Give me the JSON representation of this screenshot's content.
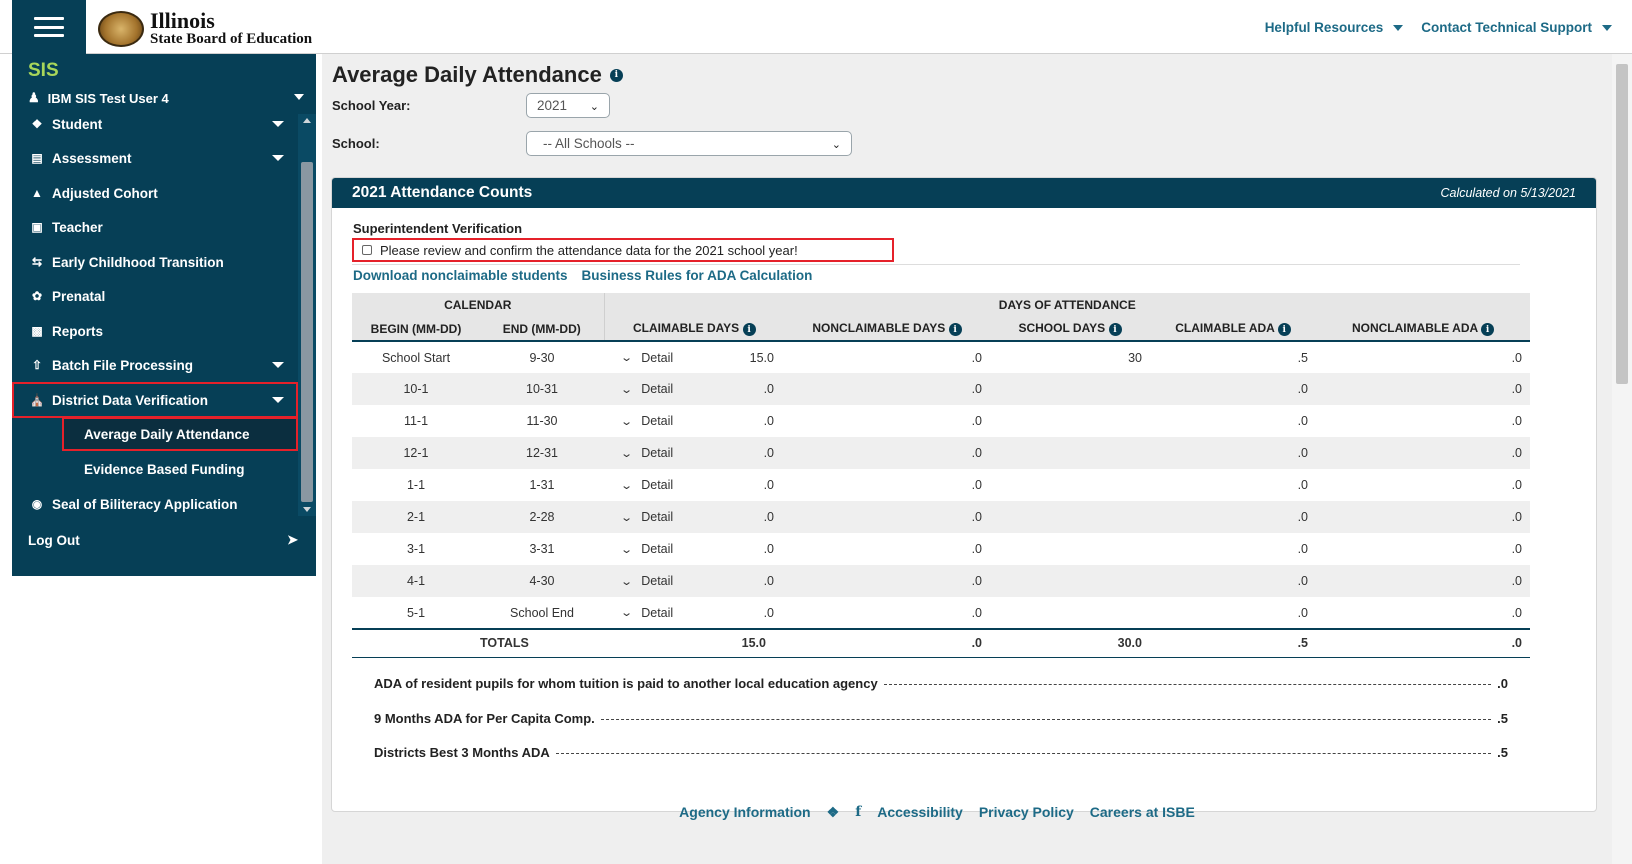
{
  "header": {
    "logo_line1": "Illinois",
    "logo_line2": "State Board of Education",
    "links": [
      "Helpful Resources",
      "Contact Technical Support"
    ]
  },
  "sidebar": {
    "app": "SIS",
    "user": "IBM SIS Test User 4",
    "items": [
      {
        "label": "Student",
        "icon": "student-icon"
      },
      {
        "label": "Assessment",
        "icon": "assessment-icon"
      },
      {
        "label": "Adjusted Cohort",
        "icon": "cohort-icon"
      },
      {
        "label": "Teacher",
        "icon": "teacher-icon"
      },
      {
        "label": "Early Childhood Transition",
        "icon": "transition-icon"
      },
      {
        "label": "Prenatal",
        "icon": "prenatal-icon"
      },
      {
        "label": "Reports",
        "icon": "reports-icon"
      },
      {
        "label": "Batch File Processing",
        "icon": "upload-icon"
      },
      {
        "label": "District Data Verification",
        "icon": "district-icon"
      }
    ],
    "subitems": [
      "Average Daily Attendance",
      "Evidence Based Funding"
    ],
    "seal": "Seal of Biliteracy Application",
    "logout": "Log Out"
  },
  "main": {
    "title": "Average Daily Attendance",
    "school_year_label": "School Year:",
    "school_year_value": "2021",
    "school_label": "School:",
    "school_value": "-- All Schools --",
    "card_title": "2021 Attendance Counts",
    "calculated": "Calculated on 5/13/2021",
    "sv_label": "Superintendent Verification",
    "confirm_text": "Please review and confirm the attendance data for the  2021 school year!",
    "link1": "Download nonclaimable students",
    "link2": "Business Rules for ADA Calculation",
    "group_calendar": "CALENDAR",
    "group_days": "DAYS OF ATTENDANCE",
    "columns": [
      "BEGIN (MM-DD)",
      "END (MM-DD)",
      "CLAIMABLE DAYS",
      "NONCLAIMABLE DAYS",
      "SCHOOL DAYS",
      "CLAIMABLE ADA",
      "NONCLAIMABLE ADA"
    ],
    "detail_label": "Detail",
    "rows": [
      {
        "begin": "School Start",
        "end": "9-30",
        "claimable": "15.0",
        "nonclaimable": ".0",
        "school_days": "30",
        "claimable_ada": ".5",
        "nonclaimable_ada": ".0"
      },
      {
        "begin": "10-1",
        "end": "10-31",
        "claimable": ".0",
        "nonclaimable": ".0",
        "school_days": "",
        "claimable_ada": ".0",
        "nonclaimable_ada": ".0"
      },
      {
        "begin": "11-1",
        "end": "11-30",
        "claimable": ".0",
        "nonclaimable": ".0",
        "school_days": "",
        "claimable_ada": ".0",
        "nonclaimable_ada": ".0"
      },
      {
        "begin": "12-1",
        "end": "12-31",
        "claimable": ".0",
        "nonclaimable": ".0",
        "school_days": "",
        "claimable_ada": ".0",
        "nonclaimable_ada": ".0"
      },
      {
        "begin": "1-1",
        "end": "1-31",
        "claimable": ".0",
        "nonclaimable": ".0",
        "school_days": "",
        "claimable_ada": ".0",
        "nonclaimable_ada": ".0"
      },
      {
        "begin": "2-1",
        "end": "2-28",
        "claimable": ".0",
        "nonclaimable": ".0",
        "school_days": "",
        "claimable_ada": ".0",
        "nonclaimable_ada": ".0"
      },
      {
        "begin": "3-1",
        "end": "3-31",
        "claimable": ".0",
        "nonclaimable": ".0",
        "school_days": "",
        "claimable_ada": ".0",
        "nonclaimable_ada": ".0"
      },
      {
        "begin": "4-1",
        "end": "4-30",
        "claimable": ".0",
        "nonclaimable": ".0",
        "school_days": "",
        "claimable_ada": ".0",
        "nonclaimable_ada": ".0"
      },
      {
        "begin": "5-1",
        "end": "School End",
        "claimable": ".0",
        "nonclaimable": ".0",
        "school_days": "",
        "claimable_ada": ".0",
        "nonclaimable_ada": ".0"
      }
    ],
    "totals": {
      "label": "TOTALS",
      "claimable": "15.0",
      "nonclaimable": ".0",
      "school_days": "30.0",
      "claimable_ada": ".5",
      "nonclaimable_ada": ".0"
    },
    "summary": [
      {
        "label": "ADA of resident pupils for whom tuition is paid to another local education agency",
        "value": ".0"
      },
      {
        "label": "9 Months ADA for Per Capita Comp.",
        "value": ".5"
      },
      {
        "label": "Districts Best 3 Months ADA",
        "value": ".5"
      }
    ]
  },
  "footer": {
    "agency": "Agency Information",
    "twitter_icon": "twitter-icon",
    "facebook_icon": "facebook-icon",
    "accessibility": "Accessibility",
    "privacy": "Privacy Policy",
    "careers": "Careers at ISBE"
  }
}
